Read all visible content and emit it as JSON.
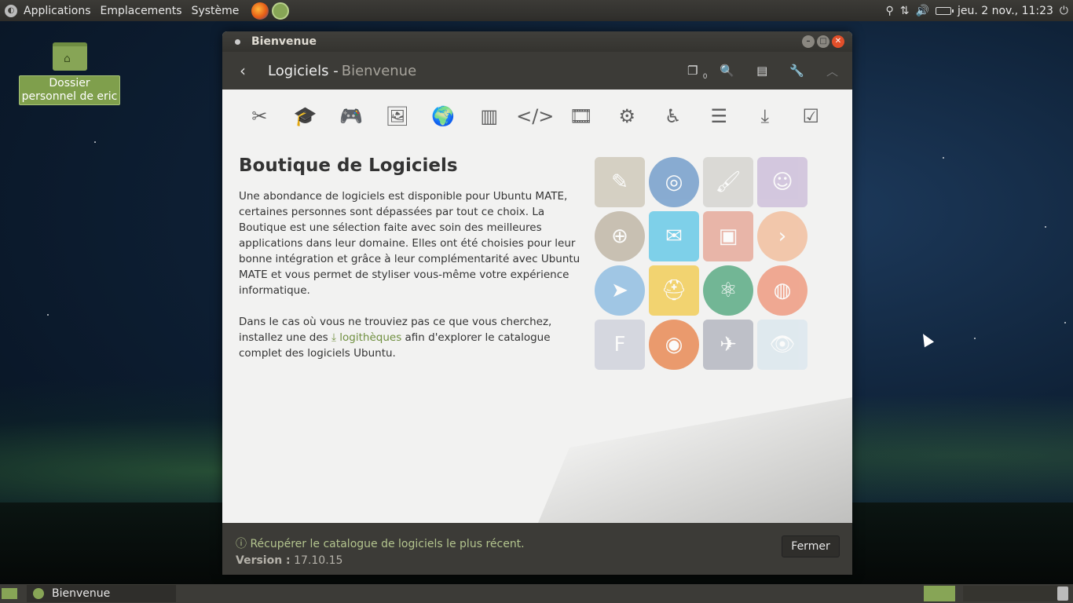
{
  "top_panel": {
    "menus": [
      "Applications",
      "Emplacements",
      "Système"
    ],
    "clock": "jeu. 2 nov., 11:23"
  },
  "desktop": {
    "icon_label": "Dossier personnel de eric"
  },
  "window": {
    "title": "Bienvenue",
    "header_title": "Logiciels -",
    "header_subtitle": "Bienvenue",
    "queue_count": "0"
  },
  "categories": [
    "scissors-icon",
    "graduation-cap-icon",
    "gamepad-icon",
    "image-icon",
    "globe-icon",
    "chart-icon",
    "code-icon",
    "film-icon",
    "gear-icon",
    "accessibility-icon",
    "server-icon",
    "download-icon",
    "checkbox-icon"
  ],
  "store": {
    "title": "Boutique de Logiciels",
    "para1": "Une abondance de logiciels est disponible pour Ubuntu MATE, certaines personnes sont dépassées par tout ce choix. La Boutique est une sélection faite avec soin des meilleures applications dans leur domaine. Elles ont été choisies pour leur bonne intégration et grâce à leur complémentarité avec Ubuntu MATE et vous permet de styliser vous-même votre expérience informatique.",
    "para2_before": "Dans le cas où vous ne trouviez pas ce que vous cherchez, installez une des",
    "link_label": "logithèques",
    "para2_after": "afin d'explorer le catalogue complet des logiciels Ubuntu."
  },
  "footer": {
    "refresh_label": "Récupérer le catalogue de logiciels le plus récent.",
    "version_label": "Version :",
    "version_value": "17.10.15",
    "close_label": "Fermer"
  },
  "taskbar": {
    "task_label": "Bienvenue"
  }
}
